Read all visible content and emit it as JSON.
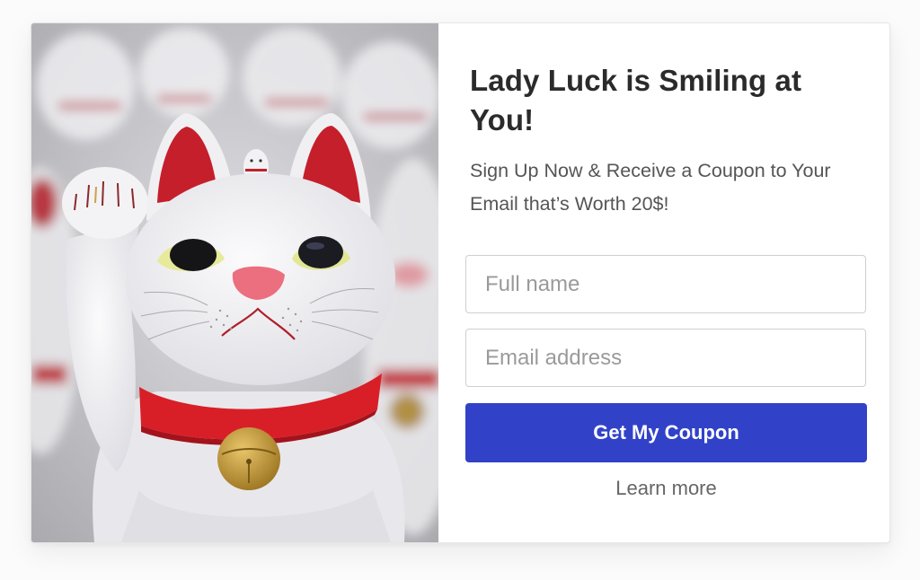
{
  "popup": {
    "title": "Lady Luck is Smiling at You!",
    "subtitle": "Sign Up Now & Receive a Coupon to Your Email that’s Worth 20$!",
    "name_placeholder": "Full name",
    "email_placeholder": "Email address",
    "cta_label": "Get My Coupon",
    "learn_more_label": "Learn more"
  },
  "image": {
    "subject": "maneki-neko-lucky-cat-figurine"
  },
  "colors": {
    "accent": "#3142c9",
    "title": "#2b2b2b",
    "text": "#555555",
    "placeholder": "#9a9a9a",
    "border": "#cfcfcf"
  }
}
